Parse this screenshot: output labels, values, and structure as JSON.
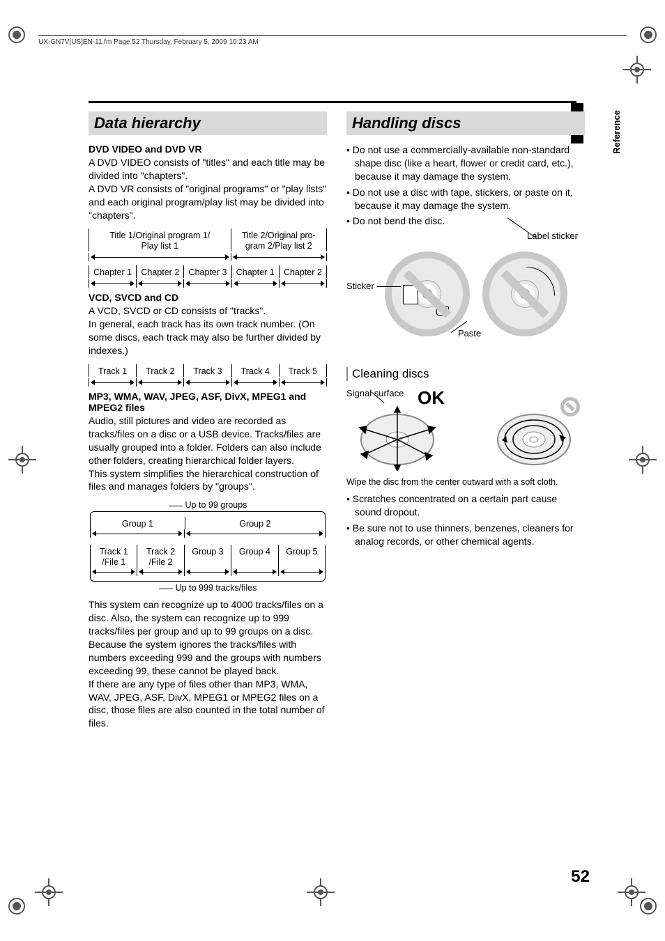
{
  "header": "UX-GN7V[US]EN-11.fm  Page 52  Thursday, February 5, 2009  10:23 AM",
  "sideTab": "Reference",
  "pageNumber": "52",
  "left": {
    "title": "Data hierarchy",
    "sub1": "DVD VIDEO and DVD VR",
    "p1a": "A DVD VIDEO consists of \"titles\" and each title may be divided into \"chapters\".",
    "p1b": "A DVD VR consists of \"original programs\" or \"play lists\" and each original program/play list may be divided into \"chapters\".",
    "diag1_title1": "Title 1/Original program 1/\nPlay list 1",
    "diag1_title2": "Title 2/Original pro-\ngram 2/Play list 2",
    "diag1_ch": [
      "Chapter 1",
      "Chapter 2",
      "Chapter 3",
      "Chapter 1",
      "Chapter 2"
    ],
    "sub2": "VCD, SVCD and CD",
    "p2a": "A VCD, SVCD or CD consists of \"tracks\".",
    "p2b": "In general, each track has its own track number. (On some discs, each track may also be further divided by indexes.)",
    "diag2_tracks": [
      "Track 1",
      "Track 2",
      "Track 3",
      "Track 4",
      "Track 5"
    ],
    "sub3": "MP3, WMA, WAV, JPEG, ASF, DivX, MPEG1 and MPEG2 files",
    "p3a": "Audio, still pictures and video are recorded as tracks/files on a disc or a USB device. Tracks/files are usually grouped into a folder. Folders can also include other folders, creating hierarchical folder layers.",
    "p3b": "This system simplifies the hierarchical construction of files and manages folders by \"groups\".",
    "diag3_top": "Up to 99 groups",
    "diag3_groups": [
      "Group 1",
      "Group 2"
    ],
    "diag3_items": [
      "Track 1\n/File 1",
      "Track 2\n/File 2",
      "Group 3",
      "Group 4",
      "Group 5"
    ],
    "diag3_bot": "Up to 999 tracks/files",
    "p4a": "This system can recognize up to 4000 tracks/files on a disc. Also, the system can recognize up to 999 tracks/files per group and up to 99 groups on a disc. Because the system ignores the tracks/files with numbers exceeding 999 and the groups with numbers exceeding 99, these cannot be played back.",
    "p4b": "If there are any type of files other than MP3, WMA, WAV, JPEG, ASF, DivX, MPEG1 or MPEG2 files on a disc, those files are also counted in the total number of files."
  },
  "right": {
    "title": "Handling discs",
    "bullets1": [
      "Do not use a commercially-available non-standard shape disc (like a heart, flower or credit card, etc.), because it may damage the system.",
      "Do not use a disc with tape, stickers, or paste on it, because it may damage the system.",
      "Do not bend the disc."
    ],
    "lbl_labelsticker": "Label sticker",
    "lbl_sticker": "Sticker",
    "lbl_paste": "Paste",
    "sub_clean": "Cleaning discs",
    "lbl_signal": "Signal surface",
    "ok": "OK",
    "p_wipe": "Wipe the disc from the center outward with a soft cloth.",
    "bullets2": [
      "Scratches concentrated on a certain part cause sound dropout.",
      "Be sure not to use thinners, benzenes, cleaners for analog records, or other chemical agents."
    ]
  }
}
